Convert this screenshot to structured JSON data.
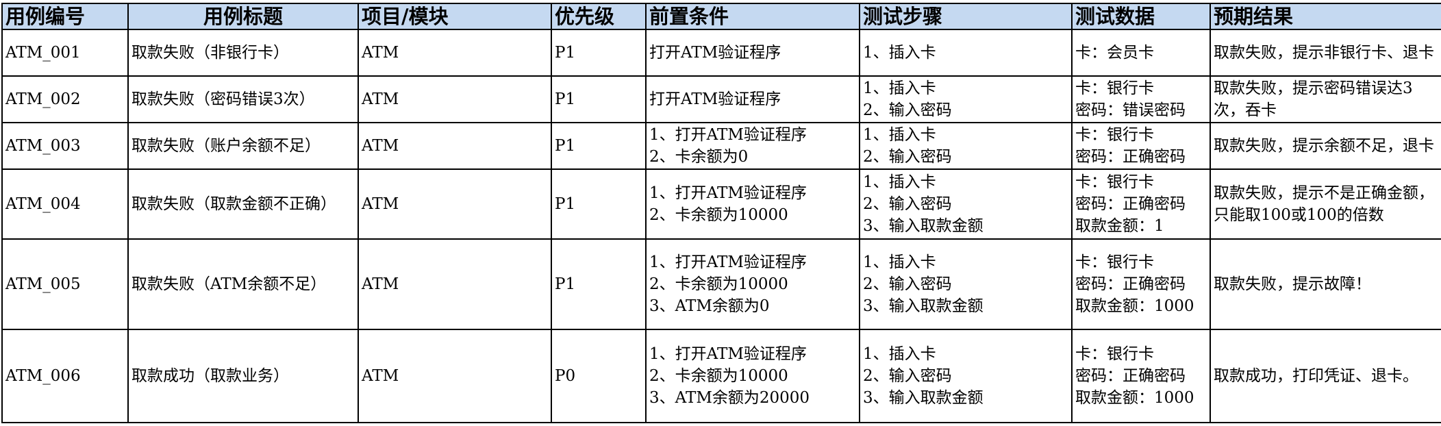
{
  "headers": {
    "id": "用例编号",
    "title": "用例标题",
    "module": "项目/模块",
    "priority": "优先级",
    "precondition": "前置条件",
    "steps": "测试步骤",
    "data": "测试数据",
    "expected": "预期结果"
  },
  "rows": [
    {
      "id": "ATM_001",
      "title": "取款失败（非银行卡）",
      "module": "ATM",
      "priority": "P1",
      "precondition": [
        "打开ATM验证程序"
      ],
      "steps": [
        "1、插入卡"
      ],
      "data": [
        "卡：会员卡"
      ],
      "expected": "取款失败，提示非银行卡、退卡"
    },
    {
      "id": "ATM_002",
      "title": "取款失败（密码错误3次）",
      "module": "ATM",
      "priority": "P1",
      "precondition": [
        "打开ATM验证程序"
      ],
      "steps": [
        "1、插入卡",
        "2、输入密码"
      ],
      "data": [
        "卡：银行卡",
        "密码：错误密码"
      ],
      "expected": "取款失败，提示密码错误达3次，吞卡"
    },
    {
      "id": "ATM_003",
      "title": "取款失败（账户余额不足）",
      "module": "ATM",
      "priority": "P1",
      "precondition": [
        "1、打开ATM验证程序",
        "2、卡余额为0"
      ],
      "steps": [
        "1、插入卡",
        "2、输入密码"
      ],
      "data": [
        "卡：银行卡",
        "密码：正确密码"
      ],
      "expected": "取款失败，提示余额不足，退卡"
    },
    {
      "id": "ATM_004",
      "title": "取款失败（取款金额不正确）",
      "module": "ATM",
      "priority": "P1",
      "precondition": [
        "1、打开ATM验证程序",
        "2、卡余额为10000"
      ],
      "steps": [
        "1、插入卡",
        "2、输入密码",
        "3、输入取款金额"
      ],
      "data": [
        "卡：银行卡",
        "密码：正确密码",
        "取款金额：1"
      ],
      "expected": "取款失败，提示不是正确金额，只能取100或100的倍数"
    },
    {
      "id": "ATM_005",
      "title": "取款失败（ATM余额不足）",
      "module": "ATM",
      "priority": "P1",
      "precondition": [
        "1、打开ATM验证程序",
        "2、卡余额为10000",
        "3、ATM余额为0"
      ],
      "steps": [
        "1、插入卡",
        "2、输入密码",
        "3、输入取款金额"
      ],
      "data": [
        "卡：银行卡",
        "密码：正确密码",
        "取款金额：1000"
      ],
      "expected": "取款失败，提示故障！"
    },
    {
      "id": "ATM_006",
      "title": "取款成功（取款业务）",
      "module": "ATM",
      "priority": "P0",
      "precondition": [
        "1、打开ATM验证程序",
        "2、卡余额为10000",
        "3、ATM余额为20000"
      ],
      "steps": [
        "1、插入卡",
        "2、输入密码",
        "3、输入取款金额"
      ],
      "data": [
        "卡：银行卡",
        "密码：正确密码",
        "取款金额：1000"
      ],
      "expected": "取款成功，打印凭证、退卡。"
    }
  ]
}
